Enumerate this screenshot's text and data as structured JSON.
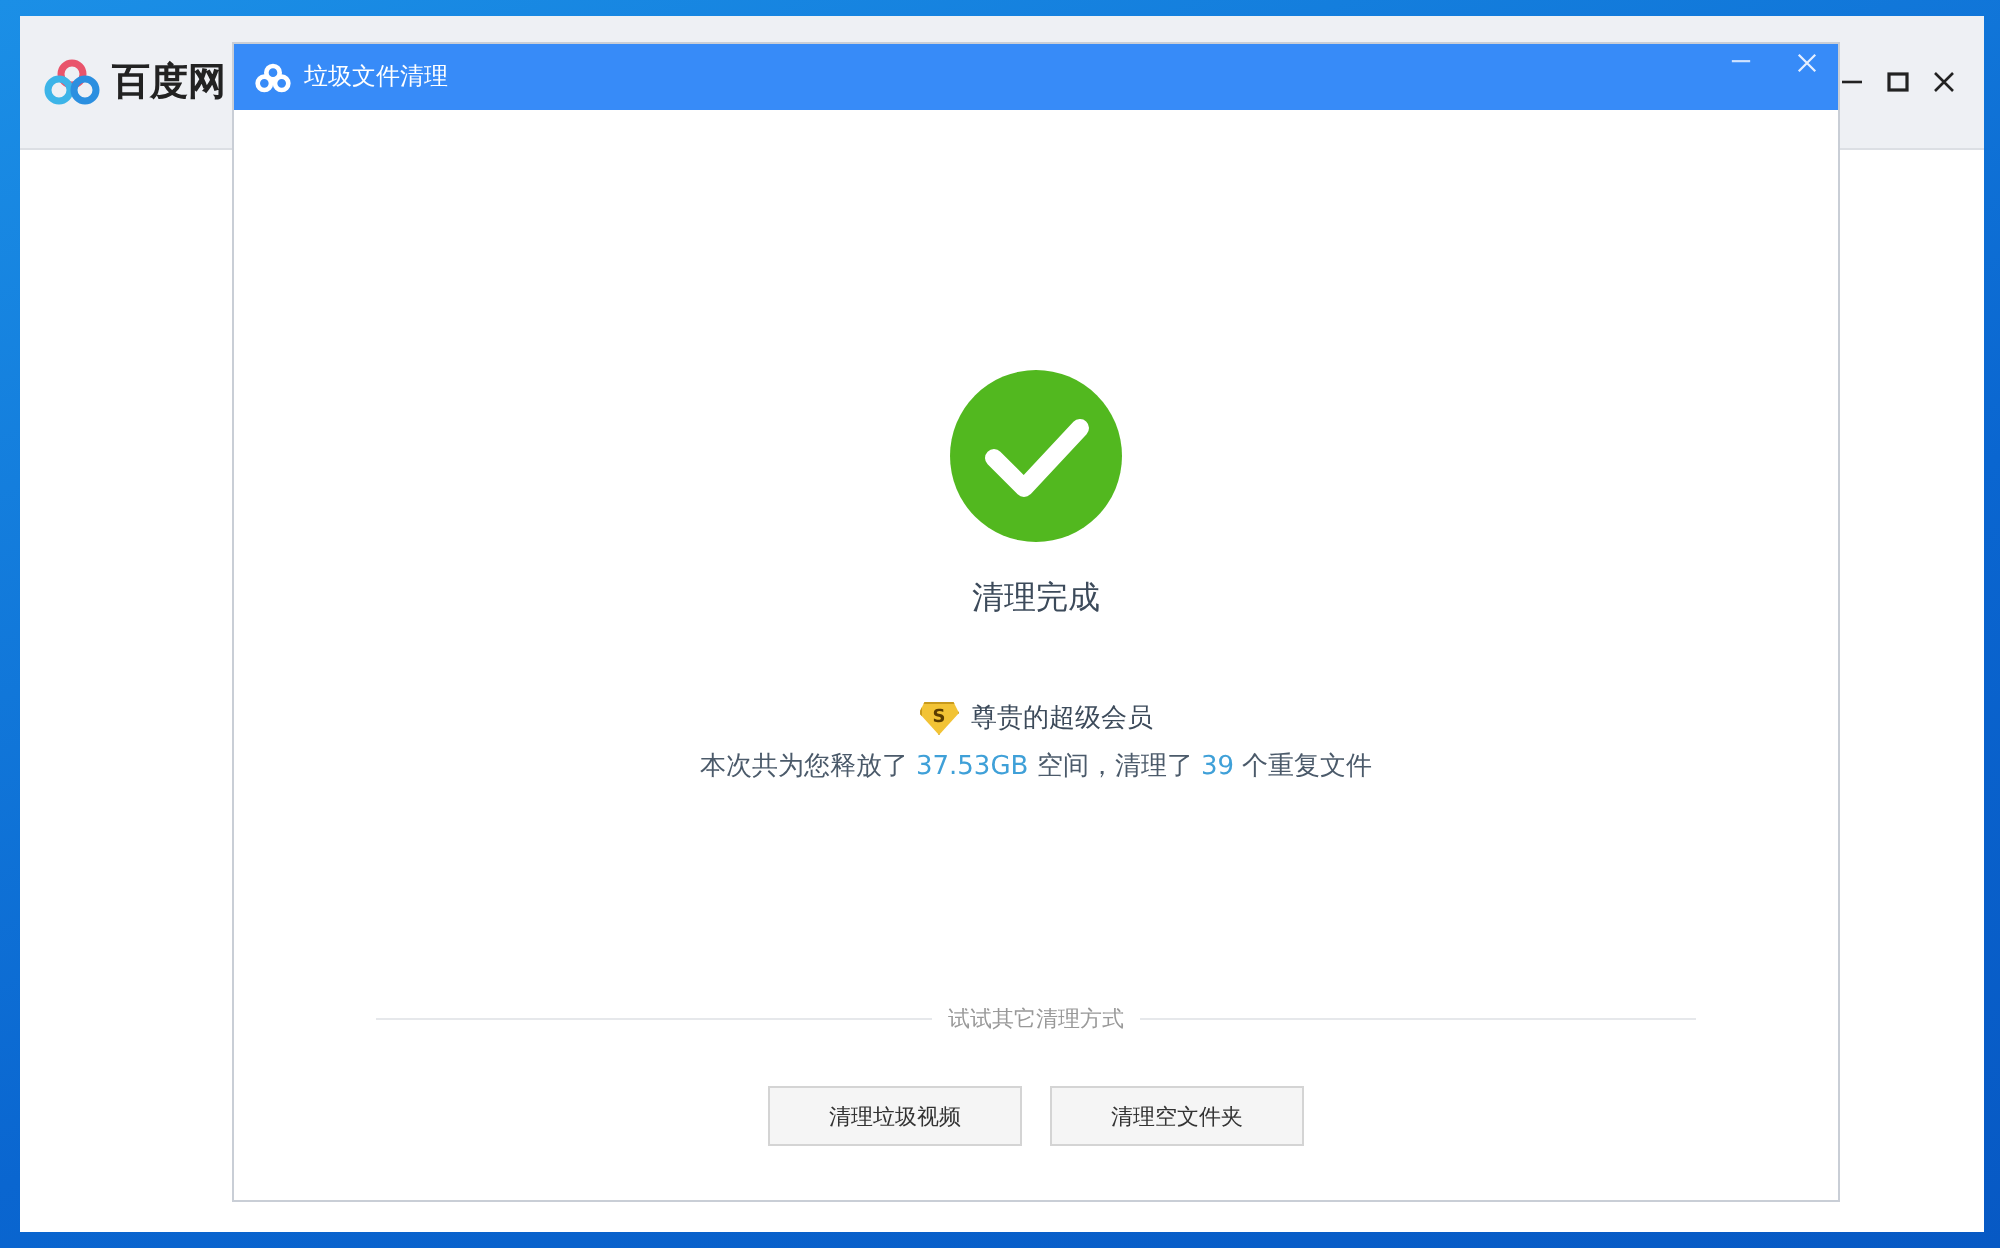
{
  "app": {
    "title": "百度网"
  },
  "dialog": {
    "title": "垃圾文件清理",
    "status": "清理完成",
    "badge_symbol": "S",
    "member_label": "尊贵的超级会员",
    "summary": [
      {
        "text": "本次共为您释放了 ",
        "highlight": false
      },
      {
        "text": "37.53GB",
        "highlight": true
      },
      {
        "text": " 空间，清理了 ",
        "highlight": false
      },
      {
        "text": "39",
        "highlight": true
      },
      {
        "text": " 个重复文件",
        "highlight": false
      }
    ],
    "other_methods_label": "试试其它清理方式",
    "buttons": [
      "清理垃圾视频",
      "清理空文件夹"
    ]
  }
}
